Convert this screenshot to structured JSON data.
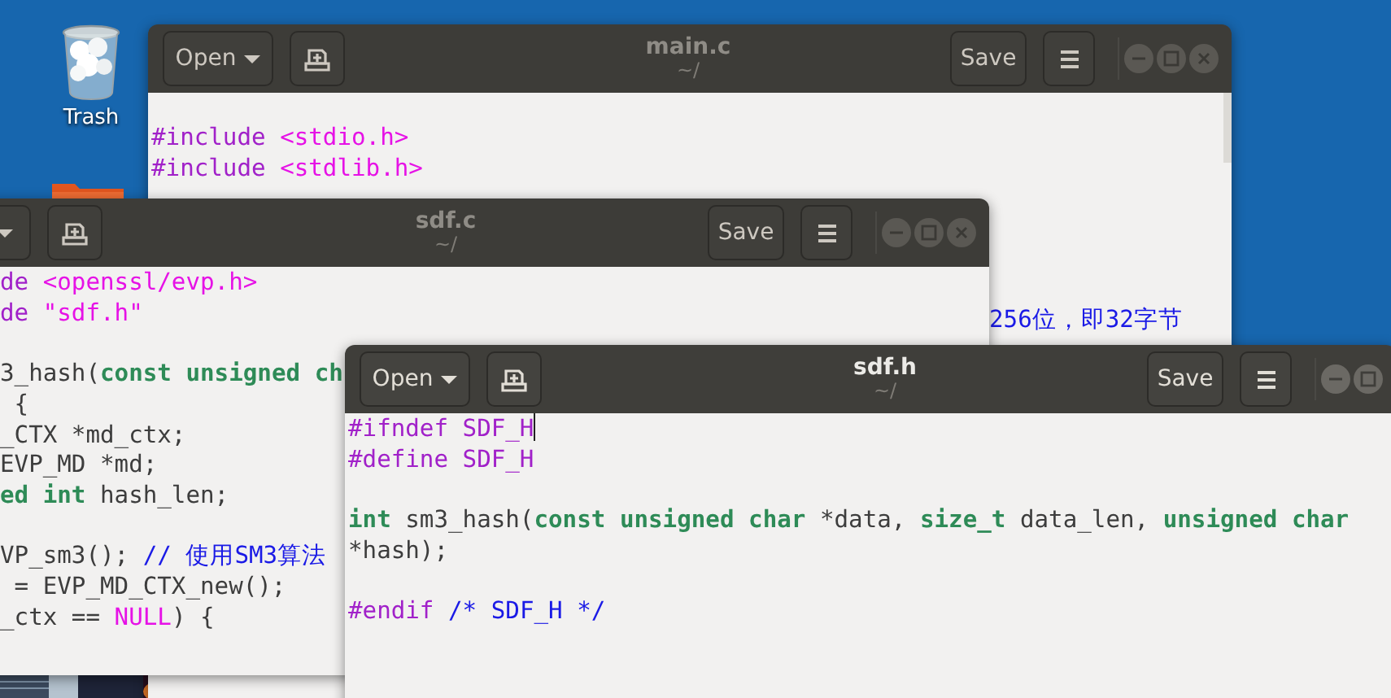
{
  "desktop": {
    "icons": [
      {
        "kind": "trash",
        "label": "Trash"
      },
      {
        "kind": "folder"
      }
    ]
  },
  "windows": [
    {
      "title": "main.c",
      "subtitle": "~/",
      "focused": false,
      "open_label": "Open",
      "save_label": "Save",
      "controls": [
        {
          "kind": "minimize"
        },
        {
          "kind": "maximize"
        },
        {
          "kind": "close"
        }
      ],
      "lines": [
        {
          "blank_before": false,
          "tokens": [
            {
              "kind": "preprocessor",
              "text": "#include "
            },
            {
              "kind": "string",
              "text": "<stdio.h>"
            }
          ]
        },
        {
          "blank_before": false,
          "tokens": [
            {
              "kind": "preprocessor",
              "text": "#include "
            },
            {
              "kind": "string",
              "text": "<stdlib.h>"
            }
          ]
        }
      ],
      "overlap_text": {
        "kind": "comment",
        "text": "256位，即32字节"
      }
    },
    {
      "title": "sdf.c",
      "subtitle": "~/",
      "focused": false,
      "save_label": "Save",
      "controls": [
        {
          "kind": "minimize"
        },
        {
          "kind": "maximize"
        },
        {
          "kind": "close"
        }
      ],
      "lines": [
        {
          "blank_before": false,
          "tokens": [
            {
              "kind": "preprocessor",
              "text": "de "
            },
            {
              "kind": "string",
              "text": "<openssl/evp.h>"
            }
          ]
        },
        {
          "blank_before": false,
          "tokens": [
            {
              "kind": "preprocessor",
              "text": "de "
            },
            {
              "kind": "string",
              "text": "\"sdf.h\""
            }
          ]
        },
        {
          "blank_before": true,
          "tokens": [
            {
              "kind": "plain",
              "text": "3_hash("
            },
            {
              "kind": "type",
              "text": "const "
            },
            {
              "kind": "type",
              "text": "unsigned "
            },
            {
              "kind": "type",
              "text": "ch"
            }
          ]
        },
        {
          "blank_before": false,
          "tokens": [
            {
              "kind": "plain",
              "text": " {"
            }
          ]
        },
        {
          "blank_before": false,
          "tokens": [
            {
              "kind": "plain",
              "text": "_CTX *md_ctx;"
            }
          ]
        },
        {
          "blank_before": false,
          "tokens": [
            {
              "kind": "plain",
              "text": "EVP_MD *md;"
            }
          ]
        },
        {
          "blank_before": false,
          "tokens": [
            {
              "kind": "type",
              "text": "ed "
            },
            {
              "kind": "type",
              "text": "int"
            },
            {
              "kind": "plain",
              "text": " hash_len;"
            }
          ]
        },
        {
          "blank_before": true,
          "tokens": [
            {
              "kind": "plain",
              "text": "VP_sm3(); "
            },
            {
              "kind": "comment",
              "text": "// 使用SM3算法"
            }
          ]
        },
        {
          "blank_before": false,
          "tokens": [
            {
              "kind": "plain",
              "text": " = EVP_MD_CTX_new();"
            }
          ]
        },
        {
          "blank_before": false,
          "tokens": [
            {
              "kind": "plain",
              "text": "_ctx == "
            },
            {
              "kind": "constant",
              "text": "NULL"
            },
            {
              "kind": "plain",
              "text": ") {"
            }
          ]
        }
      ]
    },
    {
      "title": "sdf.h",
      "subtitle": "~/",
      "focused": true,
      "open_label": "Open",
      "save_label": "Save",
      "controls": [
        {
          "kind": "minimize"
        },
        {
          "kind": "maximize"
        }
      ],
      "lines": [
        {
          "blank_before": false,
          "caret": true,
          "tokens": [
            {
              "kind": "preprocessor",
              "text": "#ifndef SDF_H"
            }
          ]
        },
        {
          "blank_before": false,
          "caret": false,
          "tokens": [
            {
              "kind": "preprocessor",
              "text": "#define SDF_H"
            }
          ]
        },
        {
          "blank_before": true,
          "caret": false,
          "tokens": [
            {
              "kind": "type",
              "text": "int"
            },
            {
              "kind": "plain",
              "text": " sm3_hash("
            },
            {
              "kind": "type",
              "text": "const "
            },
            {
              "kind": "type",
              "text": "unsigned "
            },
            {
              "kind": "type",
              "text": "char"
            },
            {
              "kind": "plain",
              "text": " *data, "
            },
            {
              "kind": "type",
              "text": "size_t"
            },
            {
              "kind": "plain",
              "text": " data_len, "
            },
            {
              "kind": "type",
              "text": "unsigned "
            },
            {
              "kind": "type",
              "text": "char"
            }
          ]
        },
        {
          "blank_before": false,
          "caret": false,
          "tokens": [
            {
              "kind": "plain",
              "text": "*hash);"
            }
          ]
        },
        {
          "blank_before": true,
          "caret": false,
          "tokens": [
            {
              "kind": "preprocessor",
              "text": "#endif "
            },
            {
              "kind": "comment",
              "text": "/* SDF_H */"
            }
          ]
        }
      ]
    }
  ]
}
